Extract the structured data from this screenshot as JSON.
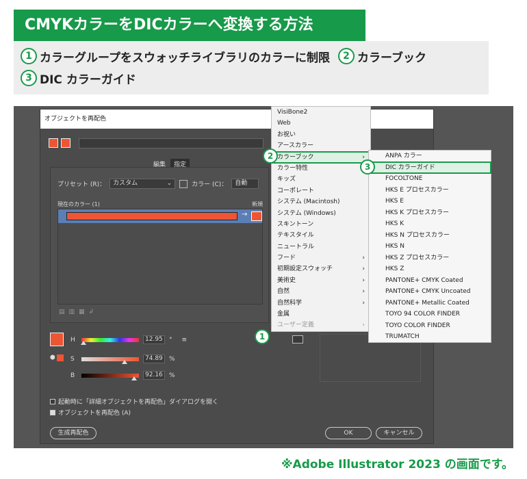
{
  "title": "CMYKカラーをDICカラーへ変換する方法",
  "steps": [
    {
      "num": "1",
      "label": "カラーグループをスウォッチライブラリのカラーに制限"
    },
    {
      "num": "2",
      "label": "カラーブック"
    },
    {
      "num": "3",
      "label": "DIC カラーガイド"
    }
  ],
  "dialog": {
    "title": "オブジェクトを再配色",
    "tabs": [
      "編集",
      "指定"
    ],
    "preset_label": "プリセット (R)：",
    "preset_value": "カスタム",
    "color_label": "カラー (C)：",
    "color_value": "自動",
    "current_colors": "現在のカラー (1)",
    "new_label": "新規",
    "sliders": [
      {
        "label": "H",
        "value": "12.95",
        "unit": "°",
        "fraction": 0.04
      },
      {
        "label": "S",
        "value": "74.89",
        "unit": "%",
        "fraction": 0.75
      },
      {
        "label": "B",
        "value": "92.16",
        "unit": "%",
        "fraction": 0.92
      }
    ],
    "checkbox1": "起動時に「詳細オブジェクトを再配色」ダイアログを開く",
    "checkbox2": "オブジェクトを再配色 (A)",
    "generate_button": "生成再配色",
    "ok_button": "OK",
    "cancel_button": "キャンセル"
  },
  "menu1": [
    {
      "label": "VisiBone2",
      "sub": false
    },
    {
      "label": "Web",
      "sub": false
    },
    {
      "label": "お祝い",
      "sub": false
    },
    {
      "label": "アースカラー",
      "sub": false
    },
    {
      "label": "カラーブック",
      "sub": true,
      "highlight": true
    },
    {
      "label": "カラー特性",
      "sub": false
    },
    {
      "label": "キッズ",
      "sub": false
    },
    {
      "label": "コーポレート",
      "sub": false
    },
    {
      "label": "システム (Macintosh)",
      "sub": false
    },
    {
      "label": "システム (Windows)",
      "sub": false
    },
    {
      "label": "スキントーン",
      "sub": false
    },
    {
      "label": "テキスタイル",
      "sub": false
    },
    {
      "label": "ニュートラル",
      "sub": false
    },
    {
      "label": "フード",
      "sub": true
    },
    {
      "label": "初期設定スウォッチ",
      "sub": true
    },
    {
      "label": "美術史",
      "sub": true
    },
    {
      "label": "自然",
      "sub": true
    },
    {
      "label": "自然科学",
      "sub": true
    },
    {
      "label": "金属",
      "sub": false
    },
    {
      "label": "ユーザー定義",
      "sub": true,
      "disabled": true
    }
  ],
  "menu2": [
    "ANPA カラー",
    "DIC カラーガイド",
    "FOCOLTONE",
    "HKS E プロセスカラー",
    "HKS E",
    "HKS K プロセスカラー",
    "HKS K",
    "HKS N プロセスカラー",
    "HKS N",
    "HKS Z プロセスカラー",
    "HKS Z",
    "PANTONE+ CMYK Coated",
    "PANTONE+ CMYK Uncoated",
    "PANTONE+ Metallic Coated",
    "TOYO 94 COLOR FINDER",
    "TOYO COLOR FINDER",
    "TRUMATCH"
  ],
  "callouts": [
    "1",
    "2",
    "3"
  ],
  "footer": "※Adobe Illustrator 2023 の画面です。",
  "colors": {
    "accent": "#179a4a",
    "swatch": "#ee5533",
    "selection": "#5b7fb5"
  }
}
